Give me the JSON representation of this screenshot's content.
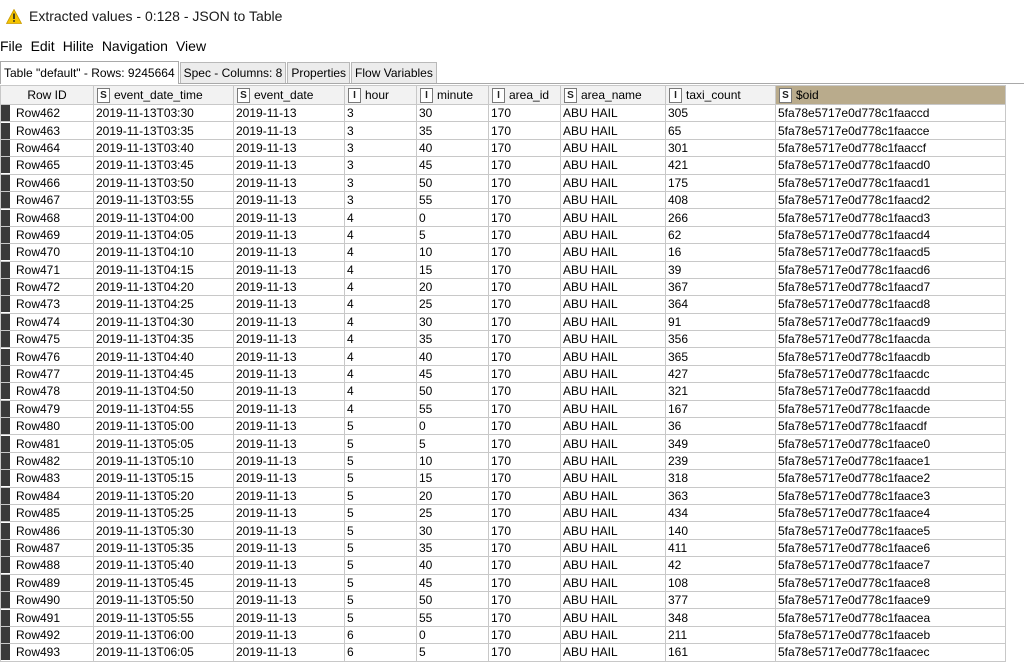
{
  "window": {
    "title": "Extracted values - 0:128 - JSON to Table",
    "title_icon": "warning-icon"
  },
  "menu": [
    "File",
    "Edit",
    "Hilite",
    "Navigation",
    "View"
  ],
  "tabs": [
    {
      "label": "Table \"default\" - Rows: 9245664",
      "active": true
    },
    {
      "label": "Spec - Columns: 8",
      "active": false
    },
    {
      "label": "Properties",
      "active": false
    },
    {
      "label": "Flow Variables",
      "active": false
    }
  ],
  "table": {
    "rowid_header": "Row ID",
    "columns": [
      {
        "type": "S",
        "name": "event_date_time"
      },
      {
        "type": "S",
        "name": "event_date"
      },
      {
        "type": "I",
        "name": "hour"
      },
      {
        "type": "I",
        "name": "minute"
      },
      {
        "type": "I",
        "name": "area_id"
      },
      {
        "type": "S",
        "name": "area_name"
      },
      {
        "type": "I",
        "name": "taxi_count"
      },
      {
        "type": "S",
        "name": "$oid"
      }
    ],
    "rows": [
      [
        "Row462",
        "2019-11-13T03:30",
        "2019-11-13",
        "3",
        "30",
        "170",
        "ABU HAIL",
        "305",
        "5fa78e5717e0d778c1faaccd"
      ],
      [
        "Row463",
        "2019-11-13T03:35",
        "2019-11-13",
        "3",
        "35",
        "170",
        "ABU HAIL",
        "65",
        "5fa78e5717e0d778c1faacce"
      ],
      [
        "Row464",
        "2019-11-13T03:40",
        "2019-11-13",
        "3",
        "40",
        "170",
        "ABU HAIL",
        "301",
        "5fa78e5717e0d778c1faaccf"
      ],
      [
        "Row465",
        "2019-11-13T03:45",
        "2019-11-13",
        "3",
        "45",
        "170",
        "ABU HAIL",
        "421",
        "5fa78e5717e0d778c1faacd0"
      ],
      [
        "Row466",
        "2019-11-13T03:50",
        "2019-11-13",
        "3",
        "50",
        "170",
        "ABU HAIL",
        "175",
        "5fa78e5717e0d778c1faacd1"
      ],
      [
        "Row467",
        "2019-11-13T03:55",
        "2019-11-13",
        "3",
        "55",
        "170",
        "ABU HAIL",
        "408",
        "5fa78e5717e0d778c1faacd2"
      ],
      [
        "Row468",
        "2019-11-13T04:00",
        "2019-11-13",
        "4",
        "0",
        "170",
        "ABU HAIL",
        "266",
        "5fa78e5717e0d778c1faacd3"
      ],
      [
        "Row469",
        "2019-11-13T04:05",
        "2019-11-13",
        "4",
        "5",
        "170",
        "ABU HAIL",
        "62",
        "5fa78e5717e0d778c1faacd4"
      ],
      [
        "Row470",
        "2019-11-13T04:10",
        "2019-11-13",
        "4",
        "10",
        "170",
        "ABU HAIL",
        "16",
        "5fa78e5717e0d778c1faacd5"
      ],
      [
        "Row471",
        "2019-11-13T04:15",
        "2019-11-13",
        "4",
        "15",
        "170",
        "ABU HAIL",
        "39",
        "5fa78e5717e0d778c1faacd6"
      ],
      [
        "Row472",
        "2019-11-13T04:20",
        "2019-11-13",
        "4",
        "20",
        "170",
        "ABU HAIL",
        "367",
        "5fa78e5717e0d778c1faacd7"
      ],
      [
        "Row473",
        "2019-11-13T04:25",
        "2019-11-13",
        "4",
        "25",
        "170",
        "ABU HAIL",
        "364",
        "5fa78e5717e0d778c1faacd8"
      ],
      [
        "Row474",
        "2019-11-13T04:30",
        "2019-11-13",
        "4",
        "30",
        "170",
        "ABU HAIL",
        "91",
        "5fa78e5717e0d778c1faacd9"
      ],
      [
        "Row475",
        "2019-11-13T04:35",
        "2019-11-13",
        "4",
        "35",
        "170",
        "ABU HAIL",
        "356",
        "5fa78e5717e0d778c1faacda"
      ],
      [
        "Row476",
        "2019-11-13T04:40",
        "2019-11-13",
        "4",
        "40",
        "170",
        "ABU HAIL",
        "365",
        "5fa78e5717e0d778c1faacdb"
      ],
      [
        "Row477",
        "2019-11-13T04:45",
        "2019-11-13",
        "4",
        "45",
        "170",
        "ABU HAIL",
        "427",
        "5fa78e5717e0d778c1faacdc"
      ],
      [
        "Row478",
        "2019-11-13T04:50",
        "2019-11-13",
        "4",
        "50",
        "170",
        "ABU HAIL",
        "321",
        "5fa78e5717e0d778c1faacdd"
      ],
      [
        "Row479",
        "2019-11-13T04:55",
        "2019-11-13",
        "4",
        "55",
        "170",
        "ABU HAIL",
        "167",
        "5fa78e5717e0d778c1faacde"
      ],
      [
        "Row480",
        "2019-11-13T05:00",
        "2019-11-13",
        "5",
        "0",
        "170",
        "ABU HAIL",
        "36",
        "5fa78e5717e0d778c1faacdf"
      ],
      [
        "Row481",
        "2019-11-13T05:05",
        "2019-11-13",
        "5",
        "5",
        "170",
        "ABU HAIL",
        "349",
        "5fa78e5717e0d778c1faace0"
      ],
      [
        "Row482",
        "2019-11-13T05:10",
        "2019-11-13",
        "5",
        "10",
        "170",
        "ABU HAIL",
        "239",
        "5fa78e5717e0d778c1faace1"
      ],
      [
        "Row483",
        "2019-11-13T05:15",
        "2019-11-13",
        "5",
        "15",
        "170",
        "ABU HAIL",
        "318",
        "5fa78e5717e0d778c1faace2"
      ],
      [
        "Row484",
        "2019-11-13T05:20",
        "2019-11-13",
        "5",
        "20",
        "170",
        "ABU HAIL",
        "363",
        "5fa78e5717e0d778c1faace3"
      ],
      [
        "Row485",
        "2019-11-13T05:25",
        "2019-11-13",
        "5",
        "25",
        "170",
        "ABU HAIL",
        "434",
        "5fa78e5717e0d778c1faace4"
      ],
      [
        "Row486",
        "2019-11-13T05:30",
        "2019-11-13",
        "5",
        "30",
        "170",
        "ABU HAIL",
        "140",
        "5fa78e5717e0d778c1faace5"
      ],
      [
        "Row487",
        "2019-11-13T05:35",
        "2019-11-13",
        "5",
        "35",
        "170",
        "ABU HAIL",
        "411",
        "5fa78e5717e0d778c1faace6"
      ],
      [
        "Row488",
        "2019-11-13T05:40",
        "2019-11-13",
        "5",
        "40",
        "170",
        "ABU HAIL",
        "42",
        "5fa78e5717e0d778c1faace7"
      ],
      [
        "Row489",
        "2019-11-13T05:45",
        "2019-11-13",
        "5",
        "45",
        "170",
        "ABU HAIL",
        "108",
        "5fa78e5717e0d778c1faace8"
      ],
      [
        "Row490",
        "2019-11-13T05:50",
        "2019-11-13",
        "5",
        "50",
        "170",
        "ABU HAIL",
        "377",
        "5fa78e5717e0d778c1faace9"
      ],
      [
        "Row491",
        "2019-11-13T05:55",
        "2019-11-13",
        "5",
        "55",
        "170",
        "ABU HAIL",
        "348",
        "5fa78e5717e0d778c1faacea"
      ],
      [
        "Row492",
        "2019-11-13T06:00",
        "2019-11-13",
        "6",
        "0",
        "170",
        "ABU HAIL",
        "211",
        "5fa78e5717e0d778c1faaceb"
      ],
      [
        "Row493",
        "2019-11-13T06:05",
        "2019-11-13",
        "6",
        "5",
        "170",
        "ABU HAIL",
        "161",
        "5fa78e5717e0d778c1faacec"
      ]
    ]
  },
  "colors": {
    "sorted_header": "#b9ab8c",
    "row_marker": "#3a3a3a",
    "warning": "#f5c400"
  }
}
